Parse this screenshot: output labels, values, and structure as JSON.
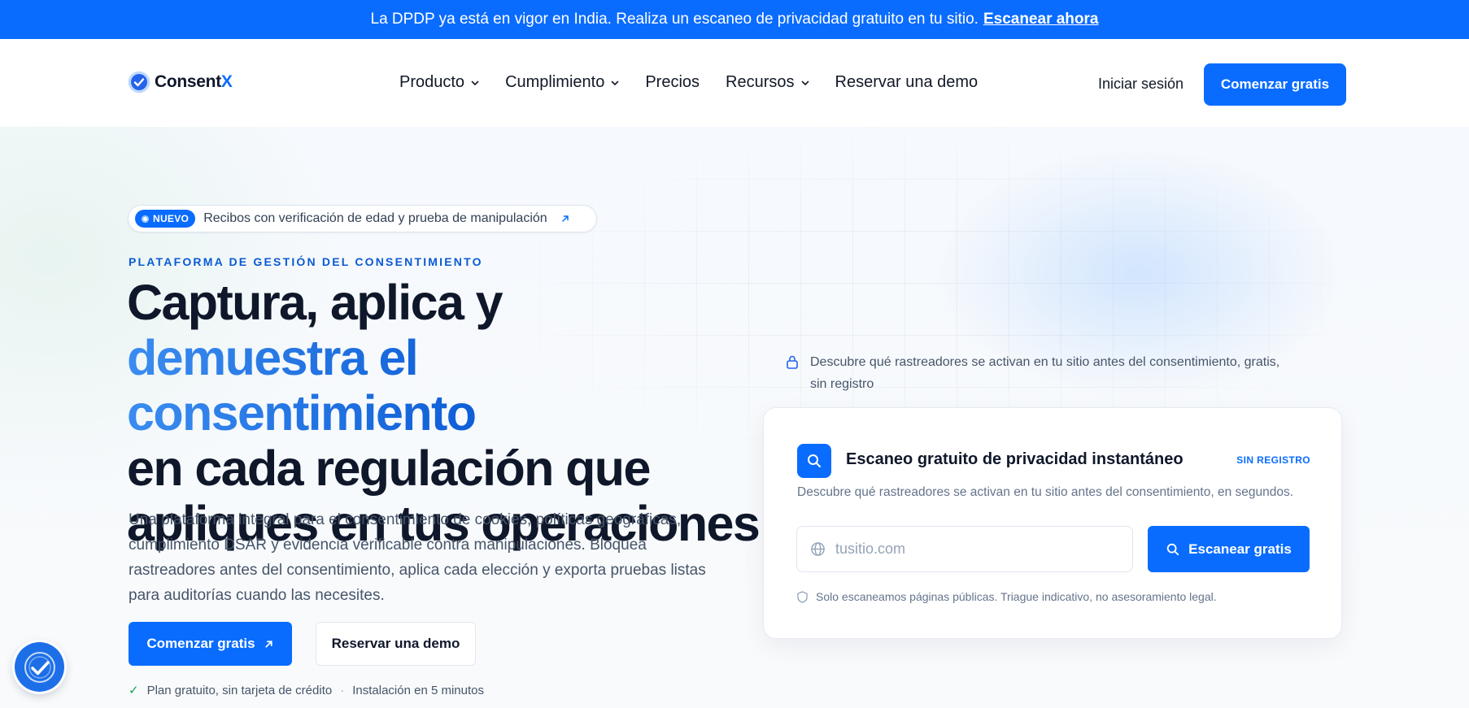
{
  "announcement": {
    "text": "La DPDP ya está en vigor en India. Realiza un escaneo de privacidad gratuito en tu sitio.",
    "link": "Escanear ahora"
  },
  "header": {
    "logo": {
      "name": "Consent",
      "suffix": "X"
    },
    "nav": [
      {
        "label": "Producto",
        "dropdown": true
      },
      {
        "label": "Cumplimiento",
        "dropdown": true
      },
      {
        "label": "Precios",
        "dropdown": false
      },
      {
        "label": "Recursos",
        "dropdown": true
      },
      {
        "label": "Reservar una demo",
        "dropdown": false
      }
    ],
    "login": "Iniciar sesión",
    "cta": "Comenzar gratis"
  },
  "hero": {
    "pill": {
      "tag": "NUEVO",
      "text": "Recibos con verificación de edad y prueba de manipulación"
    },
    "eyebrow": "PLATAFORMA DE GESTIÓN DEL CONSENTIMIENTO",
    "headline": {
      "line1": "Captura, aplica y",
      "line2": "demuestra el consentimiento",
      "line3": "en cada regulación que",
      "line4": "apliques en tus operaciones"
    },
    "subtitle": "Una plataforma integral para el consentimiento de cookies, políticas geográficas, cumplimiento DSAR y evidencia verificable contra manipulaciones. Bloquea rastreadores antes del consentimiento, aplica cada elección y exporta pruebas listas para auditorías cuando las necesites.",
    "primary_cta": "Comenzar gratis",
    "secondary_cta": "Reservar una demo",
    "perks": [
      "Plan gratuito, sin tarjeta de crédito",
      "Instalación en 5 minutos"
    ]
  },
  "note": {
    "text": "Descubre qué rastreadores se activan en tu sitio antes del consentimiento, gratis, sin registro"
  },
  "scan_card": {
    "title": "Escaneo gratuito de privacidad instantáneo",
    "badge": "SIN REGISTRO",
    "description": "Descubre qué rastreadores se activan en tu sitio antes del consentimiento, en segundos.",
    "input_placeholder": "tusitio.com",
    "button": "Escanear gratis",
    "disclaimer": "Solo escaneamos páginas públicas. Triague indicativo, no asesoramiento legal."
  },
  "colors": {
    "brand": "#0a6cff",
    "eyebrow": "#0a5ad4",
    "text": "#0f172a",
    "muted": "#475569",
    "check": "#16a34a"
  }
}
